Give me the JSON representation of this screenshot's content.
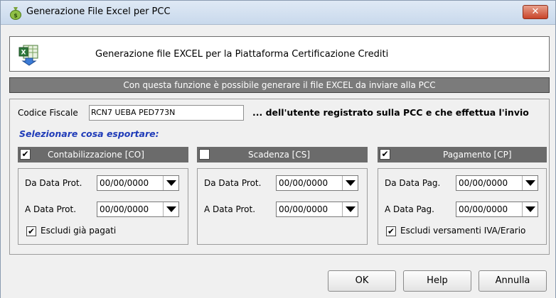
{
  "window": {
    "title": "Generazione File Excel per PCC",
    "close_label": "✕"
  },
  "header": {
    "text": "Generazione file EXCEL per la Piattaforma Certificazione Crediti"
  },
  "banner": {
    "text": "Con questa funzione è possibile generare il file EXCEL da inviare alla PCC"
  },
  "codice_fiscale": {
    "label": "Codice Fiscale",
    "value": "RCN7 UEBA PED773N",
    "note": "... dell'utente registrato sulla PCC e che effettua l'invio"
  },
  "select_label": "Selezionare cosa esportare:",
  "groups": {
    "contabilizzazione": {
      "title": "Contabilizzazione [CO]",
      "checked": true,
      "check_mark": "✔",
      "from_label": "Da Data Prot.",
      "from_value": "00/00/0000",
      "to_label": "A Data Prot.",
      "to_value": "00/00/0000",
      "exclude_label": "Escludi già pagati",
      "exclude_checked": true,
      "exclude_mark": "✔"
    },
    "scadenza": {
      "title": "Scadenza [CS]",
      "checked": false,
      "check_mark": "",
      "from_label": "Da Data Prot.",
      "from_value": "00/00/0000",
      "to_label": "A Data Prot.",
      "to_value": "00/00/0000"
    },
    "pagamento": {
      "title": "Pagamento [CP]",
      "checked": true,
      "check_mark": "✔",
      "from_label": "Da Data Pag.",
      "from_value": "00/00/0000",
      "to_label": "A Data Pag.",
      "to_value": "00/00/0000",
      "exclude_label": "Escludi versamenti IVA/Erario",
      "exclude_checked": true,
      "exclude_mark": "✔"
    }
  },
  "buttons": {
    "ok": "OK",
    "help": "Help",
    "cancel": "Annulla"
  },
  "colors": {
    "banner_bg": "#7b7b7b",
    "group_header_bg": "#6b6b6b",
    "select_label": "#1f3bb8",
    "close_button": "#c9442a"
  },
  "icons": {
    "app": "money-bag-icon",
    "header": "excel-export-icon",
    "dropdown": "chevron-down-icon"
  }
}
